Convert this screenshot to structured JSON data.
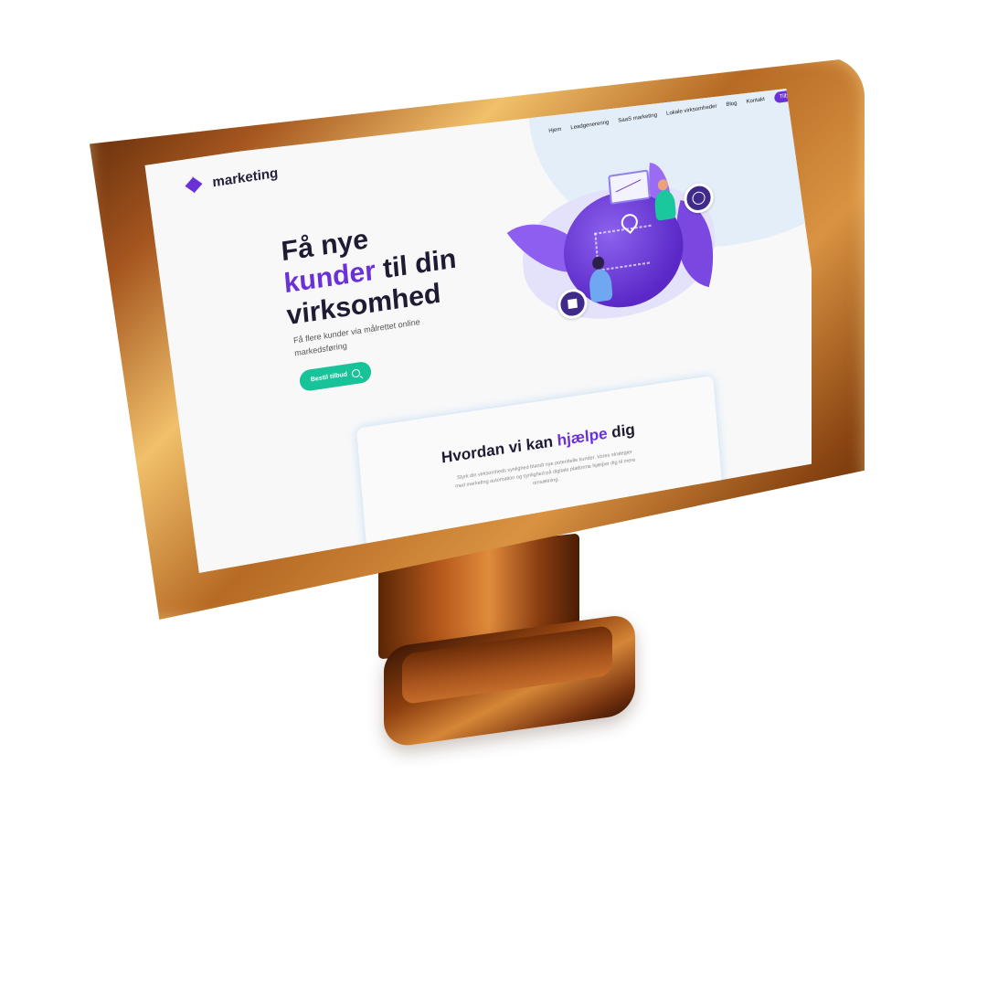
{
  "nav": {
    "items": [
      "Hjem",
      "Leadgenerering",
      "SaaS marketing",
      "Lokale virksomheder",
      "Blog",
      "Kontakt"
    ],
    "cta": "Tilbud"
  },
  "brand": {
    "logo_text": "marketing",
    "accent": "#6a32d6",
    "green": "#19c39a"
  },
  "hero": {
    "title_line1": "Få nye",
    "title_hl": "kunder",
    "title_line2_rest": " til din",
    "title_line3": "virksomhed",
    "subtitle": "Få flere kunder via målrettet online markedsføring",
    "button": "Bestil tilbud",
    "button_icon": "search-icon"
  },
  "help": {
    "title_prefix": "Hvordan vi kan ",
    "title_hl": "hjælpe",
    "title_suffix": " dig",
    "text": "Styrk din virksomheds synlighed blandt nye potentielle kunder. Vores strategier med marketing automation og synlighed på digitale platforme hjælper dig til mere omsætning."
  }
}
